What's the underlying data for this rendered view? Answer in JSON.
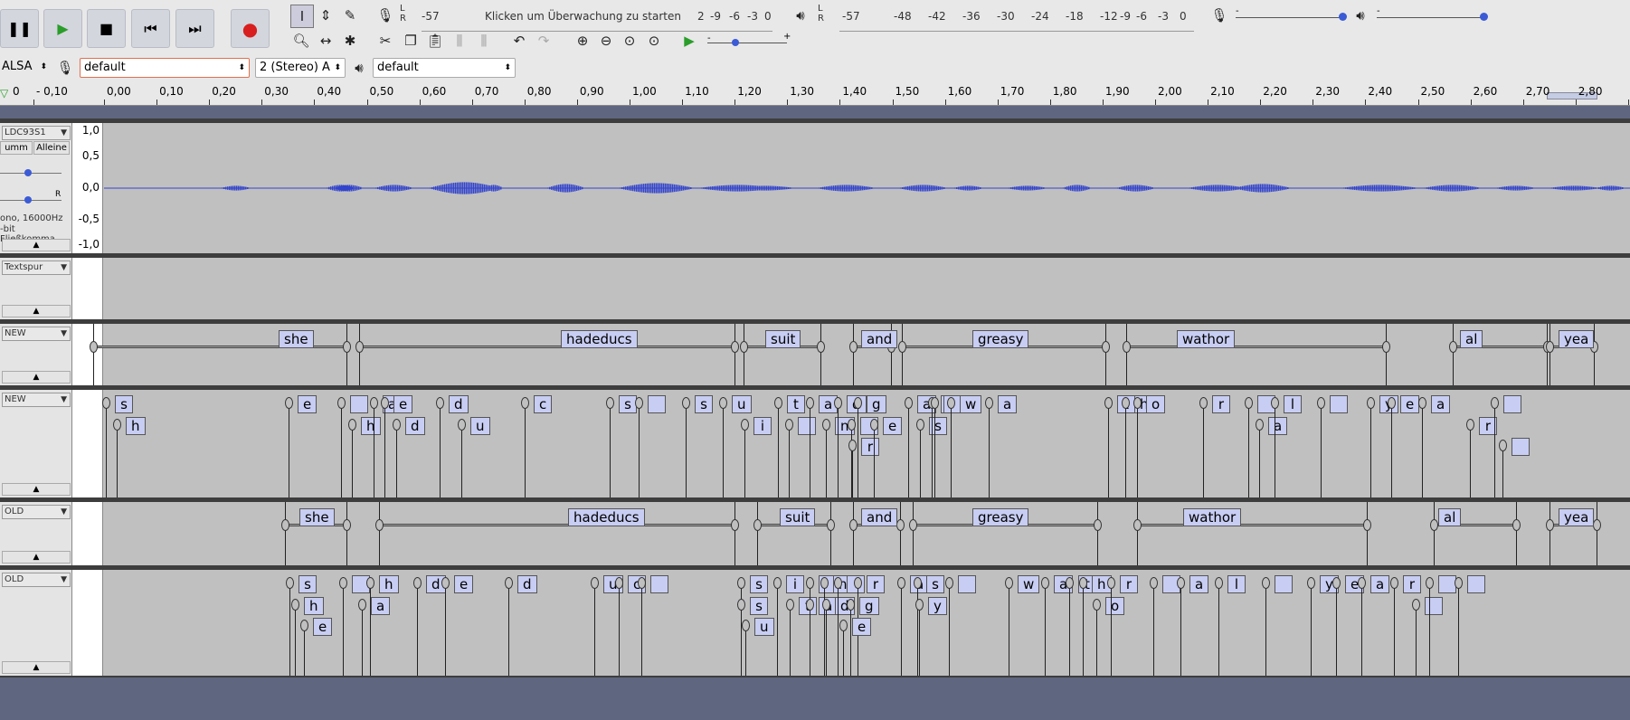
{
  "toolbar": {
    "transport": [
      "pause",
      "play",
      "stop",
      "skip-start",
      "skip-end",
      "record"
    ],
    "rec_meter": {
      "lr": "L\nR",
      "left_value": "-57",
      "prompt": "Klicken um Überwachung zu starten",
      "ticks": [
        "2",
        "-9",
        "-6",
        "-3",
        "0"
      ]
    },
    "play_meter": {
      "lr": "L\nR",
      "ticks": [
        "-57",
        "-48",
        "-42",
        "-36",
        "-30",
        "-24",
        "-18",
        "-12",
        "-9",
        "-6",
        "-3",
        "0"
      ]
    },
    "slider_minus": "-",
    "slider_plus": "+"
  },
  "device": {
    "host": "ALSA",
    "rec_device": "default",
    "channels": "2 (Stereo) A",
    "play_device": "default"
  },
  "ruler": {
    "labels": [
      "0",
      "- 0,10",
      "0,00",
      "0,10",
      "0,20",
      "0,30",
      "0,40",
      "0,50",
      "0,60",
      "0,70",
      "0,80",
      "0,90",
      "1,00",
      "1,10",
      "1,20",
      "1,30",
      "1,40",
      "1,50",
      "1,60",
      "1,70",
      "1,80",
      "1,90",
      "2,00",
      "2,10",
      "2,20",
      "2,30",
      "2,40",
      "2,50",
      "2,60",
      "2,70",
      "2,80",
      "2,"
    ]
  },
  "tracks": {
    "audio": {
      "name": "LDC93S1",
      "mute": "umm",
      "solo": "Alleine",
      "pan_label": "R",
      "format_line1": "ono, 16000Hz",
      "format_line2": "-bit Fließkomma",
      "scale": [
        "1,0",
        "0,5",
        "0,0",
        "-0,5",
        "-1,0"
      ]
    },
    "text": {
      "name": "Textspur"
    },
    "new_words": {
      "name": "NEW",
      "labels": [
        "she",
        "hadeducs",
        "suit",
        "and",
        "greasy",
        "wathor",
        "al",
        "yea"
      ]
    },
    "new_phones": {
      "name": "NEW",
      "labels": [
        "s",
        "h",
        "e",
        "",
        "h",
        "a",
        "d",
        "e",
        "d",
        "u",
        "c",
        "s",
        "",
        "s",
        "u",
        "i",
        "t",
        "",
        "a",
        "n",
        "d",
        "",
        "g",
        "r",
        "e",
        "a",
        "s",
        "y",
        "",
        "w",
        "a",
        "t",
        "h",
        "o",
        "r",
        "",
        "a",
        "l",
        "",
        "y",
        "e",
        "a",
        "r"
      ]
    },
    "old_words": {
      "name": "OLD",
      "labels": [
        "she",
        "hadeducs",
        "suit",
        "and",
        "greasy",
        "wathor",
        "al",
        "yea"
      ]
    },
    "old_phones": {
      "name": "OLD",
      "labels": [
        "s",
        "h",
        "e",
        "",
        "h",
        "a",
        "d",
        "e",
        "d",
        "u",
        "c",
        "",
        "s",
        "s",
        "u",
        "i",
        "t",
        "",
        "a",
        "n",
        "d",
        "",
        "g",
        "r",
        "e",
        "a",
        "s",
        "y",
        "",
        "w",
        "a",
        "t",
        "h",
        "o",
        "r",
        "",
        "a",
        "l",
        "",
        "y",
        "e",
        "a",
        "r"
      ]
    }
  },
  "colors": {
    "track_bg": "#c0c0c0",
    "label_fill": "#c8cdf3",
    "wave": "#3344cc",
    "separator": "#3d3d3d",
    "below_tracks": "#5f6680"
  }
}
